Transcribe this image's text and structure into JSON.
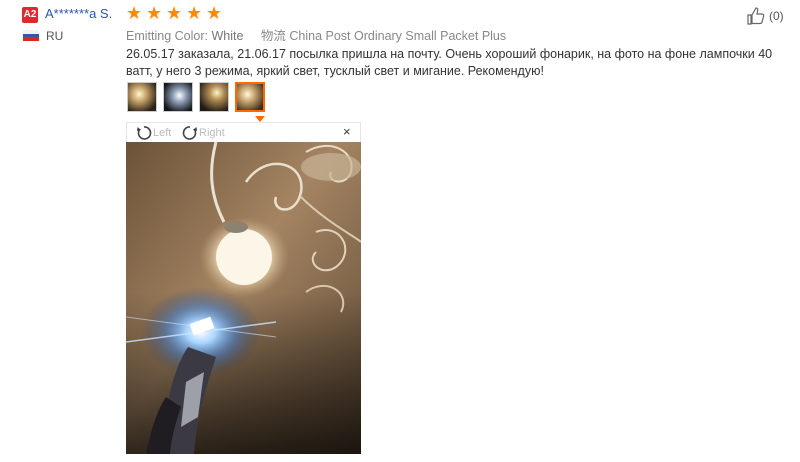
{
  "reviewer": {
    "level_badge": "A2",
    "name": "A*******a S.",
    "country": "RU",
    "flag_colors": [
      "#ffffff",
      "#3457a6",
      "#d52b1e"
    ]
  },
  "rating": {
    "stars": 5,
    "max": 5,
    "color": "#ff8a00"
  },
  "attributes": {
    "label": "Emitting Color:",
    "value": "White",
    "shipping": "物流 China Post Ordinary Small Packet Plus"
  },
  "likes": {
    "label": "(0)"
  },
  "review_text": "26.05.17 заказала, 21.06.17 посылка пришла на почту. Очень хороший фонарик, на фото на фоне лампочки 40 ватт, у него 3 режима, яркий свет, тусклый свет и мигание. Рекомендую!",
  "thumbnails": [
    {
      "name": "thumbnail-1",
      "active": false
    },
    {
      "name": "thumbnail-2",
      "active": false
    },
    {
      "name": "thumbnail-3",
      "active": false
    },
    {
      "name": "thumbnail-4",
      "active": true
    }
  ],
  "viewer": {
    "rotate_left_label": "Left",
    "rotate_right_label": "Right",
    "close_label": "×"
  },
  "colors": {
    "link": "#2a55b0",
    "accent": "#ff6a00",
    "badge": "#e0282e"
  }
}
